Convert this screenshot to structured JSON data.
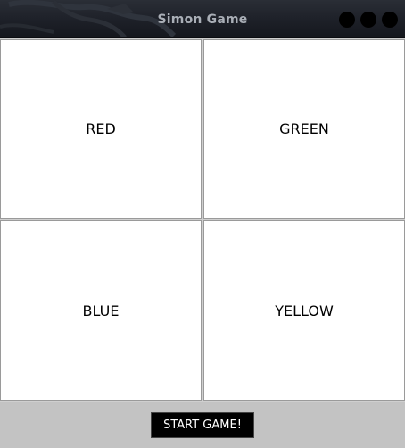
{
  "window": {
    "title": "Simon Game",
    "controls": [
      "close-dot-icon",
      "minimize-dot-icon",
      "maximize-dot-icon"
    ]
  },
  "game": {
    "pads": {
      "red": "RED",
      "green": "GREEN",
      "blue": "BLUE",
      "yellow": "YELLOW"
    },
    "start_label": "START GAME!"
  },
  "colors": {
    "titlebar": "#1d2028",
    "title_text": "#a9aeb6",
    "pad_background": "#ffffff",
    "start_button": "#000000",
    "footer": "#c3c3c3"
  }
}
